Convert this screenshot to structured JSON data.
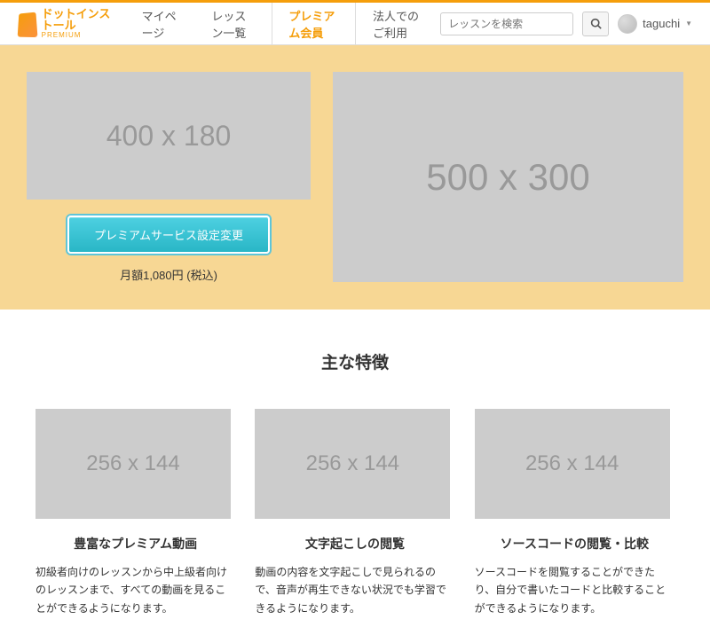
{
  "logo": {
    "title": "ドットインストール",
    "subtitle": "PREMIUM"
  },
  "nav": {
    "items": [
      {
        "label": "マイページ",
        "active": false
      },
      {
        "label": "レッスン一覧",
        "active": false
      },
      {
        "label": "プレミアム会員",
        "active": true
      },
      {
        "label": "法人でのご利用",
        "active": false
      }
    ]
  },
  "search": {
    "placeholder": "レッスンを検索"
  },
  "user": {
    "name": "taguchi"
  },
  "hero": {
    "placeholder_left": "400 x 180",
    "placeholder_right": "500 x 300",
    "button_label": "プレミアムサービス設定変更",
    "price_text": "月額1,080円 (税込)"
  },
  "features": {
    "heading": "主な特徴",
    "items": [
      {
        "placeholder": "256 x 144",
        "title": "豊富なプレミアム動画",
        "desc": "初級者向けのレッスンから中上級者向けのレッスンまで、すべての動画を見ることができるようになります。"
      },
      {
        "placeholder": "256 x 144",
        "title": "文字起こしの閲覧",
        "desc": "動画の内容を文字起こしで見られるので、音声が再生できない状況でも学習できるようになります。"
      },
      {
        "placeholder": "256 x 144",
        "title": "ソースコードの閲覧・比較",
        "desc": "ソースコードを閲覧することができたり、自分で書いたコードと比較することができるようになります。"
      }
    ]
  }
}
